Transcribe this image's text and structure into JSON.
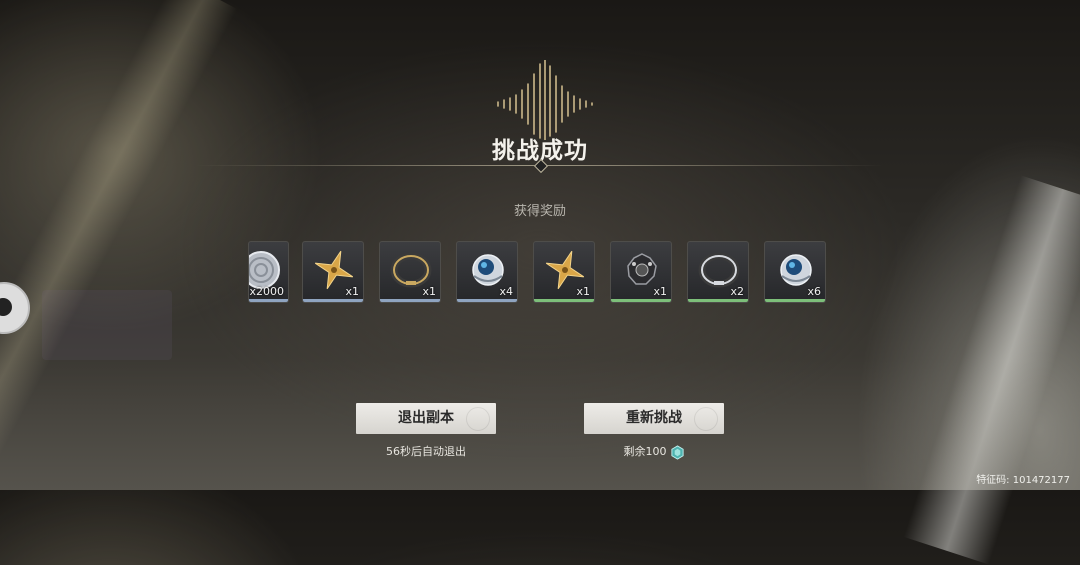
{
  "result": {
    "title": "挑战成功",
    "subtitle": "获得奖励"
  },
  "rewards": [
    {
      "icon": "silver-coin-icon",
      "qty": "x2000",
      "rarity_color": "#8fa4c0"
    },
    {
      "icon": "golden-star-shuriken-icon",
      "qty": "x1",
      "rarity_color": "#8fa4c0"
    },
    {
      "icon": "gold-ring-icon",
      "qty": "x1",
      "rarity_color": "#8fa4c0"
    },
    {
      "icon": "blue-orb-icon",
      "qty": "x4",
      "rarity_color": "#8fa4c0"
    },
    {
      "icon": "golden-star-shuriken-icon",
      "qty": "x1",
      "rarity_color": "#7dbf7a"
    },
    {
      "icon": "dark-gear-icon",
      "qty": "x1",
      "rarity_color": "#7dbf7a"
    },
    {
      "icon": "silver-ring-icon",
      "qty": "x2",
      "rarity_color": "#7dbf7a"
    },
    {
      "icon": "blue-orb-icon",
      "qty": "x6",
      "rarity_color": "#7dbf7a"
    }
  ],
  "actions": {
    "exit_label": "退出副本",
    "exit_hint": "56秒后自动退出",
    "retry_label": "重新挑战",
    "retry_hint": "剩余100"
  },
  "footer": {
    "feature_code": "特征码: 101472177"
  }
}
